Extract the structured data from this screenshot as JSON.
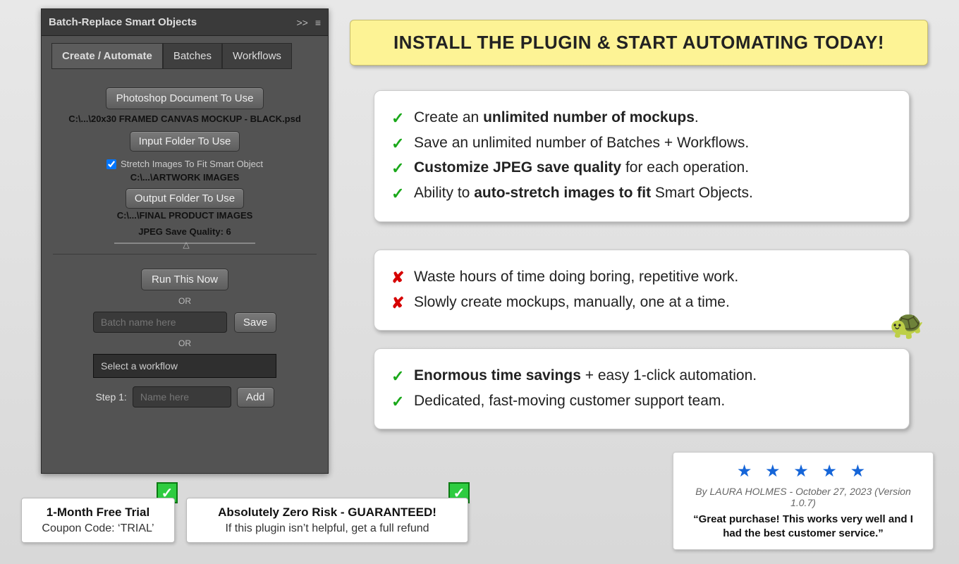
{
  "panel": {
    "title": "Batch-Replace Smart Objects",
    "collapse_icon": ">>",
    "menu_icon": "≡",
    "tabs": [
      {
        "label": "Create / Automate",
        "active": true
      },
      {
        "label": "Batches",
        "active": false
      },
      {
        "label": "Workflows",
        "active": false
      }
    ],
    "doc_button": "Photoshop Document To Use",
    "doc_path": "C:\\...\\20x30 FRAMED CANVAS MOCKUP - BLACK.psd",
    "input_button": "Input Folder To Use",
    "stretch_label": "Stretch Images To Fit Smart Object",
    "stretch_checked": true,
    "input_path": "C:\\...\\ARTWORK IMAGES",
    "output_button": "Output Folder To Use",
    "output_path": "C:\\...\\FINAL PRODUCT IMAGES",
    "jpeg_label": "JPEG Save Quality: 6",
    "run_button": "Run This Now",
    "or1": "OR",
    "batch_placeholder": "Batch name here",
    "save_button": "Save",
    "or2": "OR",
    "workflow_select": "Select a workflow",
    "step_label": "Step 1:",
    "step_placeholder": "Name here",
    "add_button": "Add"
  },
  "headline": "INSTALL THE PLUGIN & START AUTOMATING TODAY!",
  "card1": [
    {
      "pre": "Create an ",
      "bold": "unlimited number of mockups",
      "post": "."
    },
    {
      "pre": "Save an unlimited number of Batches + Workflows.",
      "bold": "",
      "post": ""
    },
    {
      "pre": "",
      "bold": "Customize JPEG save quality",
      "post": " for each operation."
    },
    {
      "pre": "Ability to ",
      "bold": "auto-stretch images to fit",
      "post": " Smart Objects."
    }
  ],
  "card2": [
    "Waste hours of time doing boring, repetitive work.",
    "Slowly create mockups, manually, one at a time."
  ],
  "turtle": "🐢",
  "card3": [
    {
      "pre": "",
      "bold": "Enormous time savings",
      "post": " + easy 1-click automation."
    },
    {
      "pre": "Dedicated, fast-moving customer support team.",
      "bold": "",
      "post": ""
    }
  ],
  "badge1": {
    "t1": "1-Month Free Trial",
    "t2": "Coupon Code: ‘TRIAL’"
  },
  "badge2": {
    "t1": "Absolutely Zero Risk - GUARANTEED!",
    "t2": "If this plugin isn’t helpful, get a full refund"
  },
  "check_glyph": "✓",
  "review": {
    "stars": "★ ★ ★ ★ ★",
    "byline": "By LAURA HOLMES - October 27, 2023 (Version 1.0.7)",
    "quote": "“Great purchase! This works very well and I had the best customer service.”"
  }
}
